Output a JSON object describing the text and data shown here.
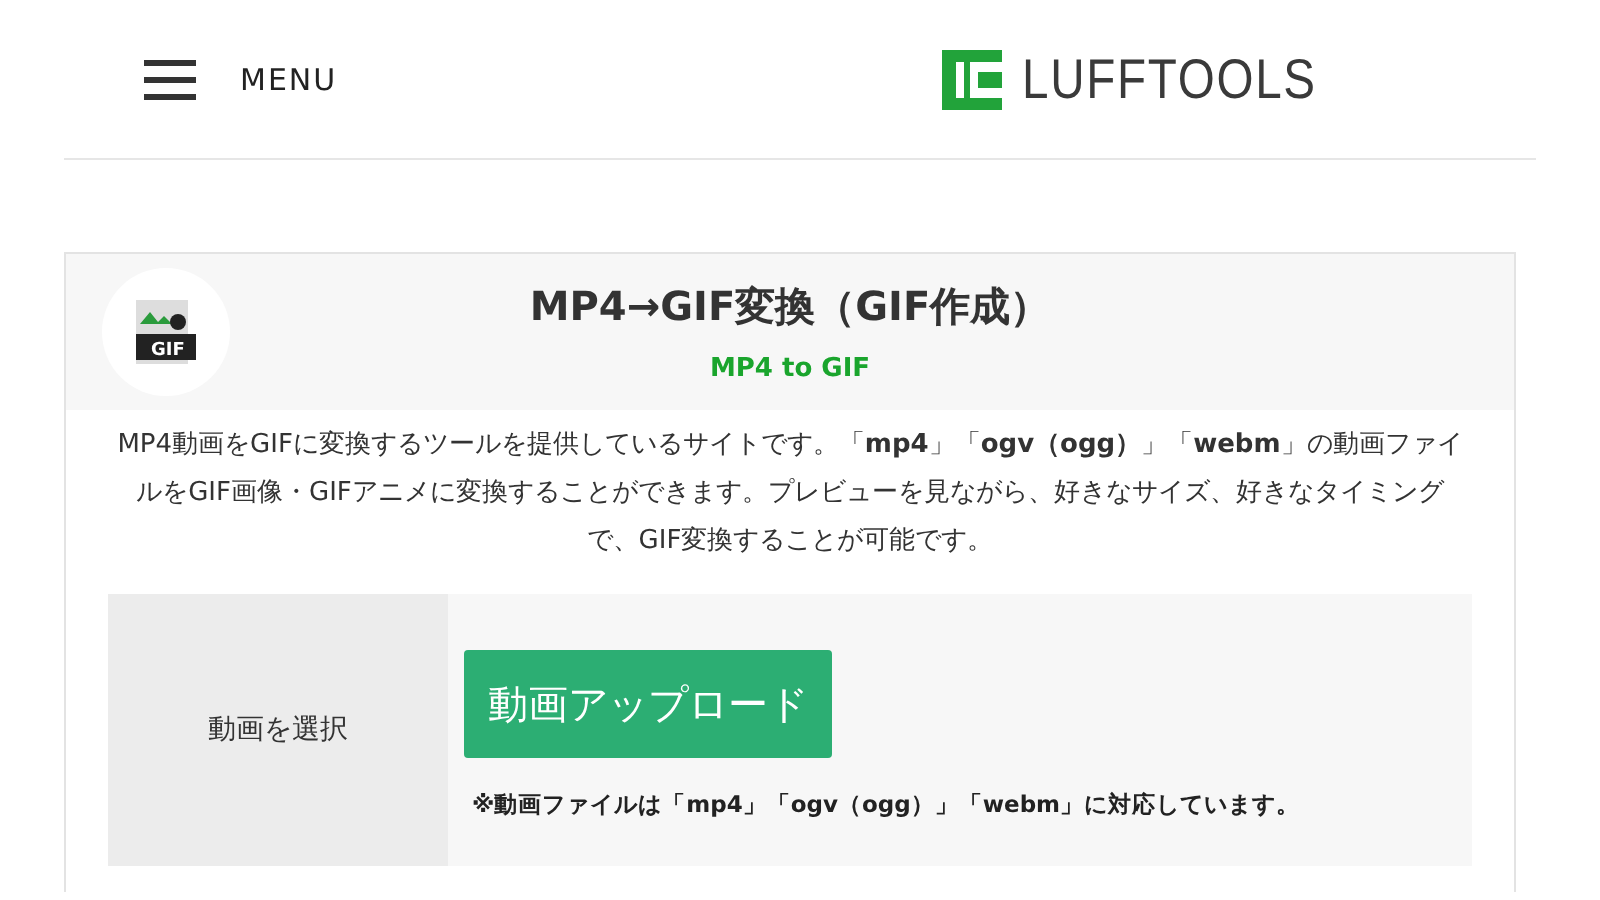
{
  "header": {
    "menu_label": "MENU",
    "logo_text": "LUFFTOOLS"
  },
  "tool": {
    "title": "MP4→GIF変換（GIF作成）",
    "subtitle": "MP4 to GIF",
    "icon_label": "GIF",
    "description": "MP4動画をGIFに変換するツールを提供しているサイトです。「**mp4**」「**ogv（ogg）**」「**webm**」の動画ファイルをGIF画像・GIFアニメに変換することができます。プレビューを見ながら、好きなサイズ、好きなタイミングで、GIF変換することが可能です。",
    "rows": [
      {
        "label": "動画を選択",
        "button": "動画アップロード",
        "note": "※動画ファイルは「mp4」「ogv（ogg）」「webm」に対応しています。"
      }
    ]
  }
}
